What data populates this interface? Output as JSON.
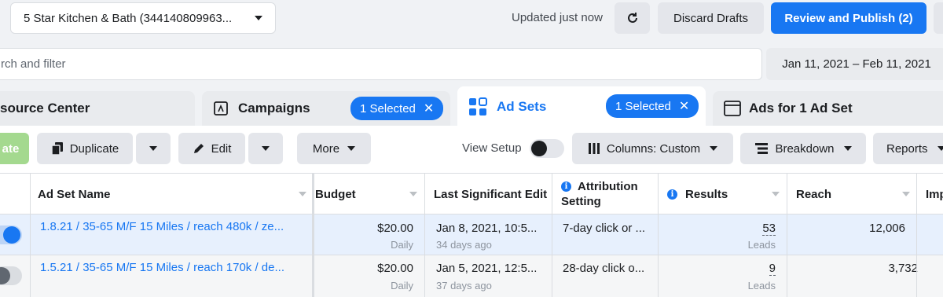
{
  "account": {
    "name": "5 Star Kitchen & Bath (344140809963..."
  },
  "header": {
    "updated_text": "Updated just now",
    "discard_label": "Discard Drafts",
    "publish_label": "Review and Publish (2)"
  },
  "search": {
    "placeholder": "rch and filter"
  },
  "date_range": "Jan 11, 2021 – Feb 11, 2021",
  "tabs": {
    "resource": "source Center",
    "campaigns": "Campaigns",
    "campaigns_selected": "1 Selected",
    "adsets": "Ad Sets",
    "adsets_selected": "1 Selected",
    "ads": "Ads for 1 Ad Set"
  },
  "toolbar": {
    "create_label": "ate",
    "duplicate_label": "Duplicate",
    "edit_label": "Edit",
    "more_label": "More",
    "view_setup_label": "View Setup",
    "columns_label": "Columns: Custom",
    "breakdown_label": "Breakdown",
    "reports_label": "Reports"
  },
  "table": {
    "headers": {
      "name": "Ad Set Name",
      "budget": "Budget",
      "last_edit": "Last Significant Edit",
      "attribution_line1": "Attribution",
      "attribution_line2": "Setting",
      "results": "Results",
      "reach": "Reach",
      "impressions": "Imp"
    },
    "rows": [
      {
        "active": true,
        "name": "1.8.21 / 35-65 M/F 15 Miles / reach 480k / ze...",
        "budget": "$20.00",
        "budget_type": "Daily",
        "last_edit": "Jan 8, 2021, 10:5...",
        "last_edit_ago": "34 days ago",
        "attribution": "7-day click or ...",
        "results": "53",
        "results_type": "Leads",
        "reach": "12,006"
      },
      {
        "active": false,
        "name": "1.5.21 / 35-65 M/F 15 Miles / reach 170k / de...",
        "budget": "$20.00",
        "budget_type": "Daily",
        "last_edit": "Jan 5, 2021, 12:5...",
        "last_edit_ago": "37 days ago",
        "attribution": "28-day click o...",
        "results": "9",
        "results_type": "Leads",
        "reach": "3,732"
      }
    ]
  },
  "colors": {
    "accent": "#1877f2",
    "create_green": "#a4d98f",
    "row_selected": "#e7f0fd"
  }
}
